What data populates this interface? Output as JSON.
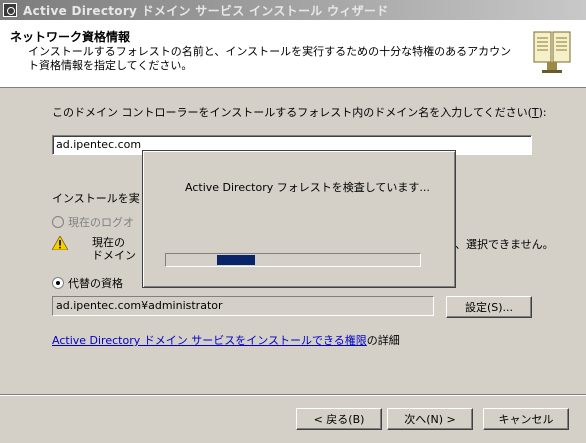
{
  "window": {
    "title": "Active Directory ドメイン サービス インストール ウィザード"
  },
  "header": {
    "title": "ネットワーク資格情報",
    "description": "インストールするフォレストの名前と、インストールを実行するための十分な特権のあるアカウント資格情報を指定してください。"
  },
  "main": {
    "domain_prompt": "このドメイン コントローラーをインストールするフォレスト内のドメイン名を入力してください(",
    "domain_prompt_key": "T",
    "domain_prompt_end": "):",
    "domain_value": "ad.ipentec.com",
    "install_label": "インストールを実",
    "radio_current": "現在のログオ",
    "warning_text_1": "現在の",
    "warning_text_2": "ドメイン",
    "warning_tail": "、選択できません。",
    "radio_alt": "代替の資格",
    "credentials_value": "ad.ipentec.com¥administrator",
    "settings_button": "設定(S)...",
    "help_link": "Active Directory ドメイン サービスをインストールできる権限",
    "help_suffix": "の詳細"
  },
  "progress": {
    "message": "Active Directory フォレストを検査しています...",
    "fraction_start": 0.2,
    "fraction_width": 0.15
  },
  "footer": {
    "back_button": "< 戻る(B)",
    "next_button": "次へ(N) >",
    "cancel_button": "キャンセル"
  },
  "icons": {
    "window_icon": "setup-wizard-icon",
    "header_icon": "book-icon",
    "warning_icon": "warning-icon"
  },
  "colors": {
    "progress_fill": "#0a246a",
    "link": "#0000cc"
  }
}
